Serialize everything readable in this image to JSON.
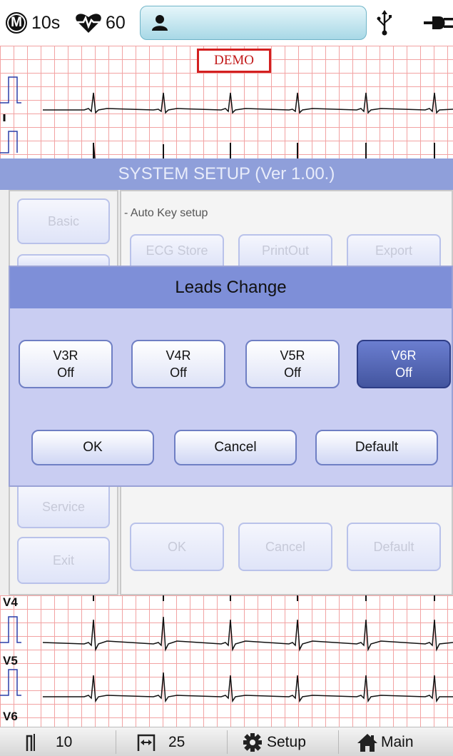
{
  "status_bar": {
    "mode_badge": "M",
    "duration": "10s",
    "heart_rate": "60",
    "patient_icon": "person-icon",
    "usb_icon": "usb-icon",
    "power_icon": "power-plug-icon"
  },
  "ecg": {
    "demo_label": "DEMO",
    "bottom_leads": [
      "V4",
      "V5",
      "V6"
    ]
  },
  "system_setup": {
    "title": "SYSTEM SETUP (Ver 1.00.)",
    "side_buttons": [
      "Basic",
      "Service",
      "Exit"
    ],
    "auto_key_label": "- Auto Key setup",
    "auto_key_buttons": [
      "ECG Store",
      "PrintOut",
      "Export"
    ],
    "footer_buttons": [
      "OK",
      "Cancel",
      "Default"
    ]
  },
  "dialog": {
    "title": "Leads Change",
    "leads": [
      {
        "name": "V3R",
        "state": "Off",
        "selected": false
      },
      {
        "name": "V4R",
        "state": "Off",
        "selected": false
      },
      {
        "name": "V5R",
        "state": "Off",
        "selected": false
      },
      {
        "name": "V6R",
        "state": "Off",
        "selected": true
      }
    ],
    "buttons": {
      "ok": "OK",
      "cancel": "Cancel",
      "default": "Default"
    }
  },
  "bottom_bar": {
    "gain": "10",
    "speed": "25",
    "setup": "Setup",
    "main": "Main"
  },
  "colors": {
    "dialog_header": "#7e8fd8",
    "dialog_body": "#c9cdf2",
    "selected_button": "#4b5daa",
    "grid": "#f2a3a3",
    "demo_border": "#d32020"
  }
}
